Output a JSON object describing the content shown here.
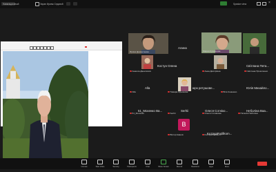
{
  "window": {
    "left_label": "Навигационный",
    "meeting_label": "Экран Ирины Седовой",
    "speaker_label": "Speaker view"
  },
  "share_toolbar": {
    "zoom": "100%"
  },
  "gallery": {
    "tiles": [
      {
        "name": "Ирина Дементеева",
        "big": ""
      },
      {
        "name": "Алина Адамскевичская",
        "big": "Алина"
      },
      {
        "name": "Мария Кузнецова",
        "big": ""
      },
      {
        "name": "Анжела Данилович",
        "big": "Костун Олена"
      },
      {
        "name": "Анна Дмитрівна",
        "big": ""
      },
      {
        "name": "Світлана Прокопенко",
        "big": "Світлана Пета..."
      },
      {
        "name": "Alla",
        "big": "Alla"
      },
      {
        "name": "Тамара Кірьянова",
        "big": "юрк ретушове..."
      },
      {
        "name": "Віта Конюшко",
        "big": "Юлія Михайло..."
      },
      {
        "name": "51_Мохенко",
        "big": "51_Мохенко Ва..."
      },
      {
        "name": "Serhii",
        "big": "Serhii"
      },
      {
        "name": "Олеся Сотнікова",
        "big": "Олеся Сотніко..."
      },
      {
        "name": "Наталія Неболіна",
        "big": "Неболіна Ваа..."
      },
      {
        "name": "Віктор Іванов",
        "big": ""
      },
      {
        "name": "KuznyaPodilkom...",
        "big": "KuznyaPodilkom..."
      }
    ],
    "avatar_letter": "B"
  },
  "bottom_bar": {
    "items": [
      "Unmute",
      "Start Video",
      "Security",
      "Participants",
      "Chat",
      "Share Screen",
      "Record",
      "Reactions",
      "Apps",
      "More"
    ]
  }
}
